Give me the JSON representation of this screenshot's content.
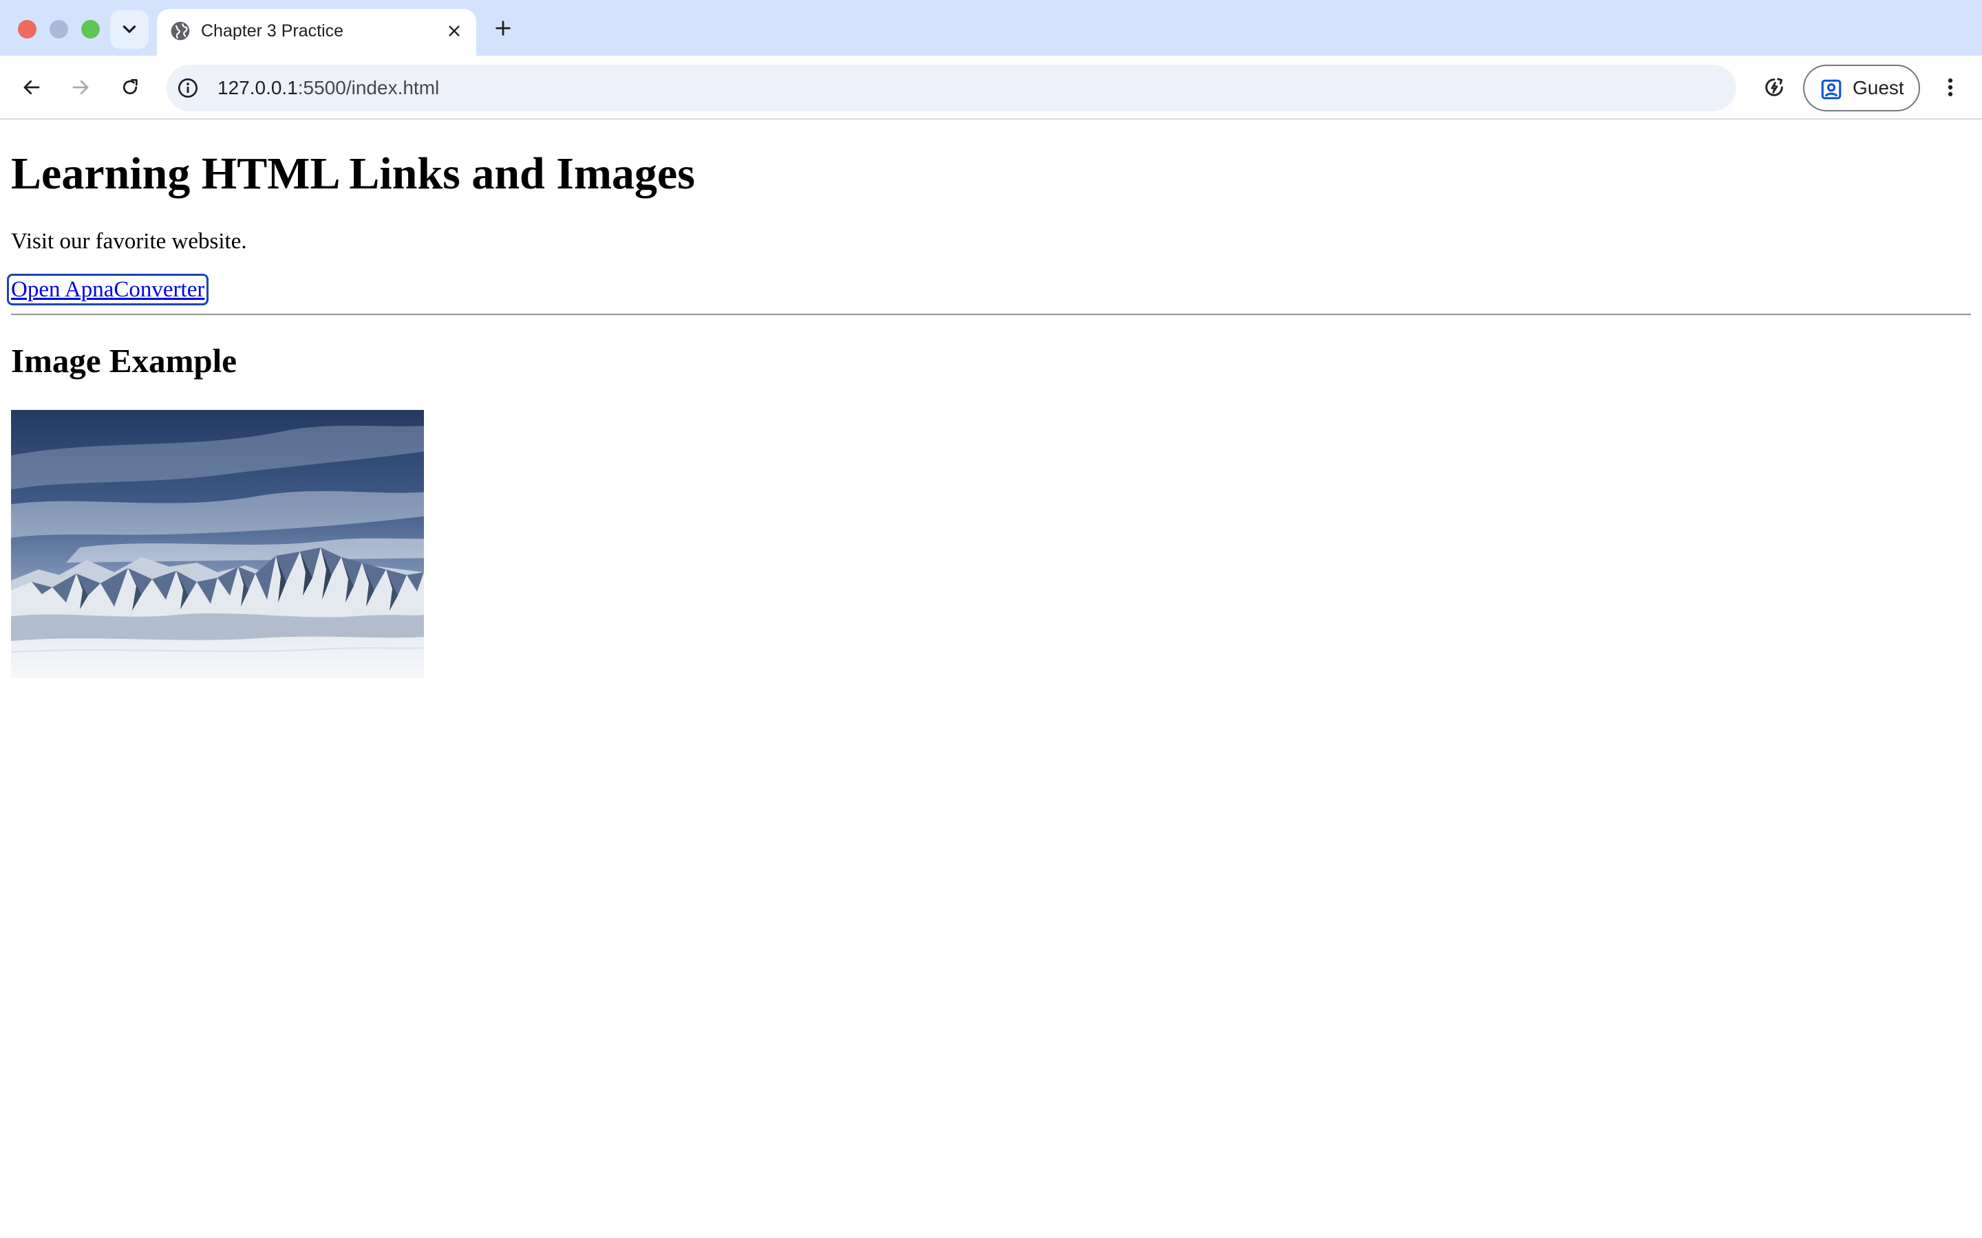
{
  "browser": {
    "tab": {
      "title": "Chapter 3 Practice"
    },
    "address_bar": {
      "url_host": "127.0.0.1",
      "url_rest": ":5500/index.html"
    },
    "profile": {
      "label": "Guest"
    },
    "icons": {
      "tab_search": "chevron-down-icon",
      "favicon": "globe-icon",
      "tab_close": "close-icon",
      "new_tab": "plus-icon",
      "back": "arrow-left-icon",
      "forward": "arrow-right-icon",
      "reload": "reload-icon",
      "site_info": "info-icon",
      "performance": "performance-icon",
      "profile": "person-icon",
      "menu": "kebab-menu-icon"
    },
    "colors": {
      "tab_strip": "#d3e3fd",
      "omnibox": "#edf2fa",
      "close_light": "#ed6a5e",
      "min_light": "#aab9d4",
      "max_light": "#61c554"
    }
  },
  "page": {
    "heading": "Learning HTML Links and Images",
    "paragraph": "Visit our favorite website.",
    "link_text": "Open ApnaConverter",
    "subheading": "Image Example",
    "image": {
      "depicts": "snowy-mountain-range-landscape"
    },
    "colors": {
      "link": "#0000ee",
      "focus_ring": "#1a46b5"
    }
  }
}
